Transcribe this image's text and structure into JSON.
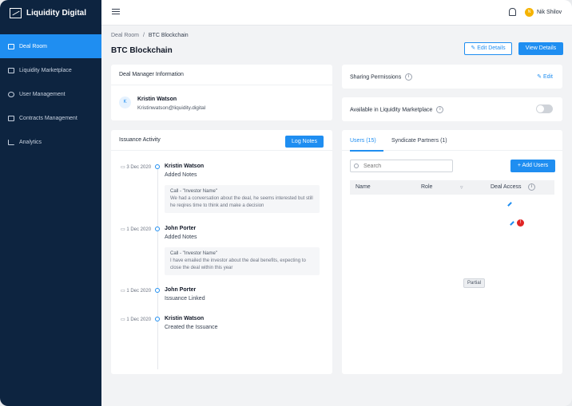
{
  "app": {
    "title": "Liquidity Digital"
  },
  "sidebar": {
    "items": [
      {
        "label": "Deal Room",
        "icon": "briefcase-icon"
      },
      {
        "label": "Liquidity Marketplace",
        "icon": "store-icon"
      },
      {
        "label": "User Management",
        "icon": "user-icon"
      },
      {
        "label": "Contracts Management",
        "icon": "document-icon"
      },
      {
        "label": "Analytics",
        "icon": "chart-icon"
      }
    ],
    "active": "Deal Room"
  },
  "topbar": {
    "user_name": "Nik Shilov",
    "avatar_initials": "N"
  },
  "breadcrumb": {
    "parent": "Deal Room",
    "separator": "/",
    "current": "BTC Blockchain"
  },
  "page": {
    "title": "BTC Blockchain",
    "edit_details_label": "Edit Details",
    "view_details_label": "View Details"
  },
  "deal_manager": {
    "heading": "Deal Manager Information",
    "initials": "K",
    "name": "Kristin Watson",
    "email": "Kristinwatson@liquidity.digital"
  },
  "sharing": {
    "label": "Sharing Permissions",
    "edit_label": "Edit"
  },
  "marketplace": {
    "label": "Available in Liquidity Marketplace",
    "toggle_on": false
  },
  "issuance": {
    "heading": "Issuance Activity",
    "log_button": "Log Notes",
    "entries": [
      {
        "date": "3 Dec 2020",
        "name": "Kristin Watson",
        "action": "Added Notes",
        "note_title": "Call - \"Investor Name\"",
        "note_body": "We had a conversation about the deal, he seems interested but still he reqires time to think and make a decision"
      },
      {
        "date": "1 Dec 2020",
        "name": "John Porter",
        "action": "Added Notes",
        "note_title": "Call - \"Investor Name\"",
        "note_body": "I have emailed the investor about the deal benefits, expecting to close the deal within this year"
      },
      {
        "date": "1 Dec 2020",
        "name": "John Porter",
        "action": "Issuance Linked"
      },
      {
        "date": "1 Dec 2020",
        "name": "Kristin Watson",
        "action": "Created the Issuance"
      }
    ]
  },
  "users_panel": {
    "tabs": [
      "Users (15)",
      "Syndicate Partners (1)"
    ],
    "search_placeholder": "Search",
    "add_button": "+ Add Users",
    "columns": [
      "Name",
      "Role",
      "Deal Access"
    ],
    "badge_count": "!",
    "partial_label": "Partial"
  },
  "colors": {
    "accent": "#1f8ef1",
    "sidebar": "#0d2440",
    "alert": "#e02424"
  }
}
